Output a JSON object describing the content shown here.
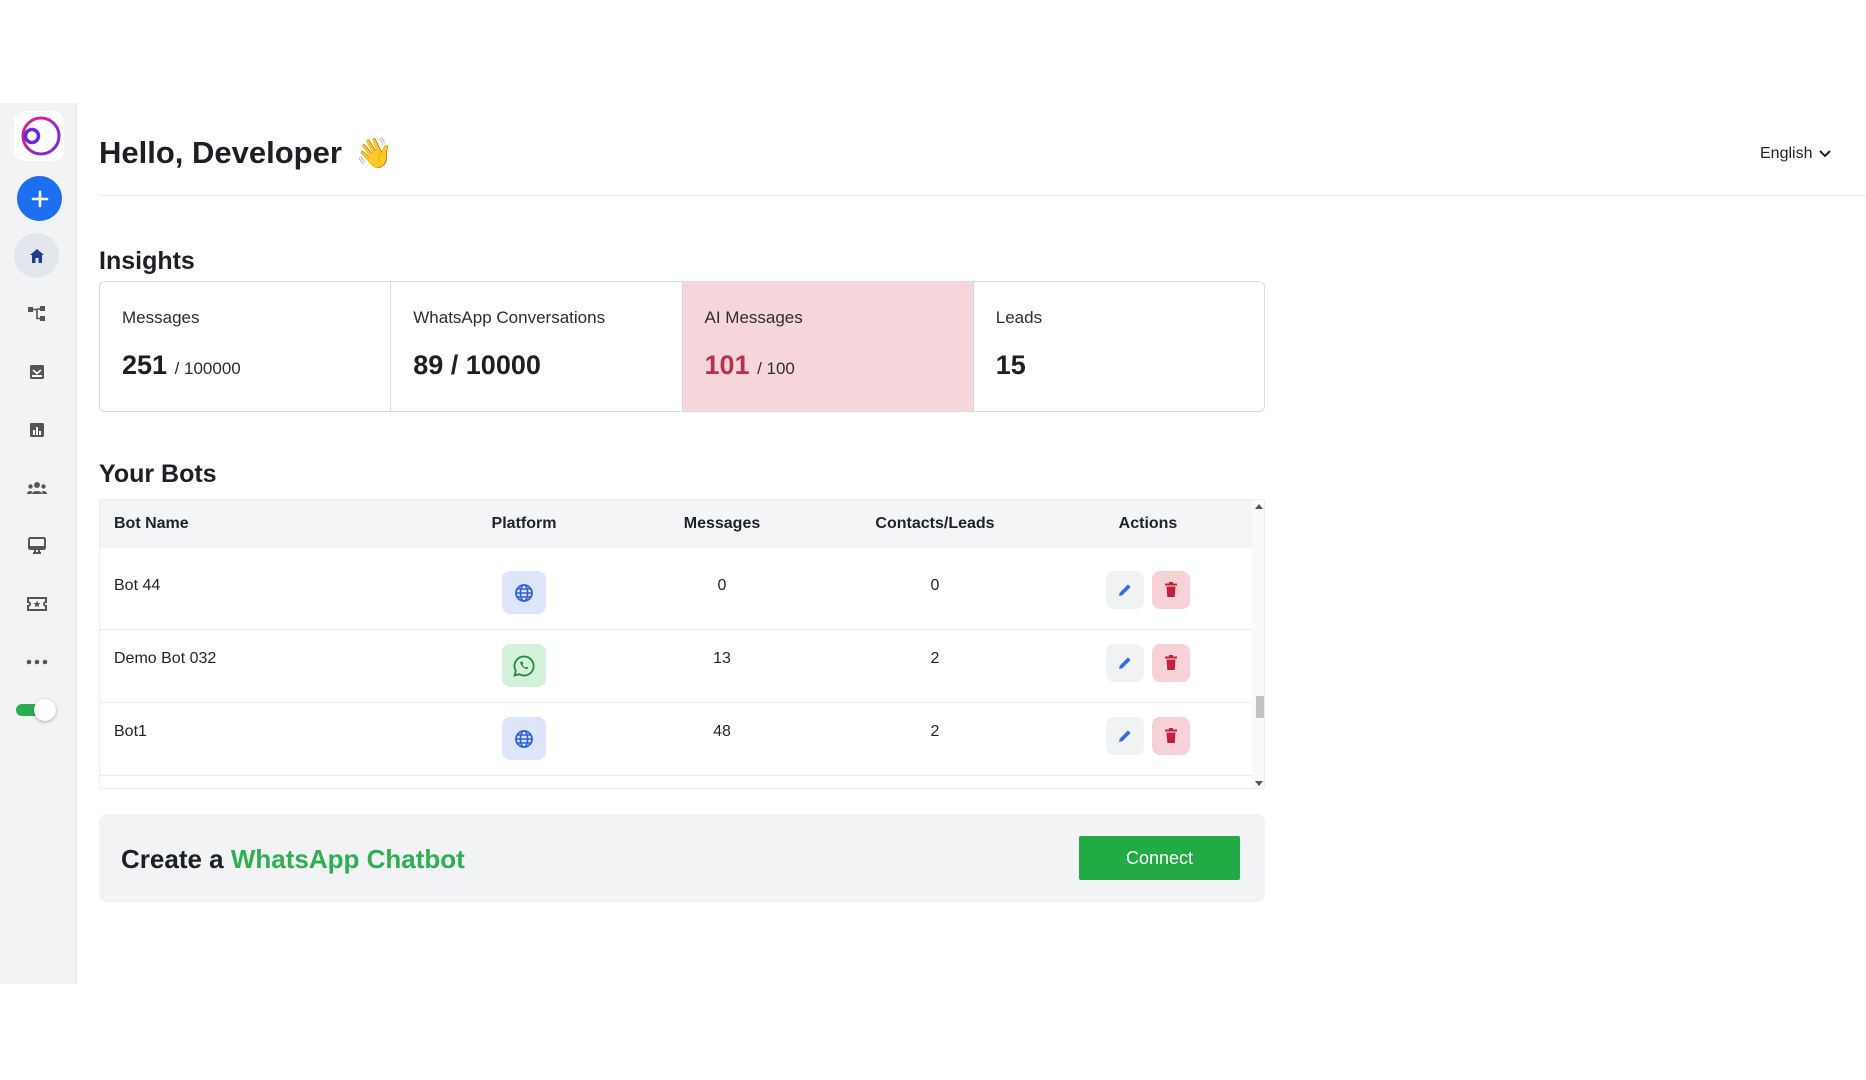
{
  "header": {
    "greeting": "Hello, Developer",
    "wave_emoji": "👋",
    "language": "English"
  },
  "sidebar": {
    "items": [
      {
        "name": "home",
        "icon": "home-icon",
        "active": true
      },
      {
        "name": "flows",
        "icon": "flow-icon"
      },
      {
        "name": "inbox",
        "icon": "inbox-icon"
      },
      {
        "name": "analytics",
        "icon": "analytics-icon"
      },
      {
        "name": "contacts",
        "icon": "contacts-icon"
      },
      {
        "name": "broadcast",
        "icon": "monitor-icon"
      },
      {
        "name": "tickets",
        "icon": "ticket-icon"
      },
      {
        "name": "more",
        "icon": "more-icon"
      }
    ],
    "toggle_on": true
  },
  "insights": {
    "title": "Insights",
    "cards": [
      {
        "label": "Messages",
        "value": "251",
        "limit": "/ 100000"
      },
      {
        "label": "WhatsApp Conversations",
        "value": "89 / 10000",
        "limit": ""
      },
      {
        "label": "AI Messages",
        "value": "101",
        "limit": "/ 100"
      },
      {
        "label": "Leads",
        "value": "15",
        "limit": ""
      }
    ]
  },
  "bots": {
    "title": "Your Bots",
    "columns": [
      "Bot Name",
      "Platform",
      "Messages",
      "Contacts/Leads",
      "Actions"
    ],
    "rows": [
      {
        "name": "Bot 44",
        "platform": "web",
        "messages": "0",
        "contacts": "0"
      },
      {
        "name": "Demo Bot 032",
        "platform": "whatsapp",
        "messages": "13",
        "contacts": "2"
      },
      {
        "name": "Bot1",
        "platform": "web",
        "messages": "48",
        "contacts": "2"
      }
    ]
  },
  "cta": {
    "prefix": "Create a",
    "highlight": "WhatsApp Chatbot",
    "button": "Connect"
  },
  "colors": {
    "accent_blue": "#1e6ff0",
    "green": "#22ab45",
    "alert_bg": "#f7d6db",
    "alert_text": "#b8334a"
  }
}
